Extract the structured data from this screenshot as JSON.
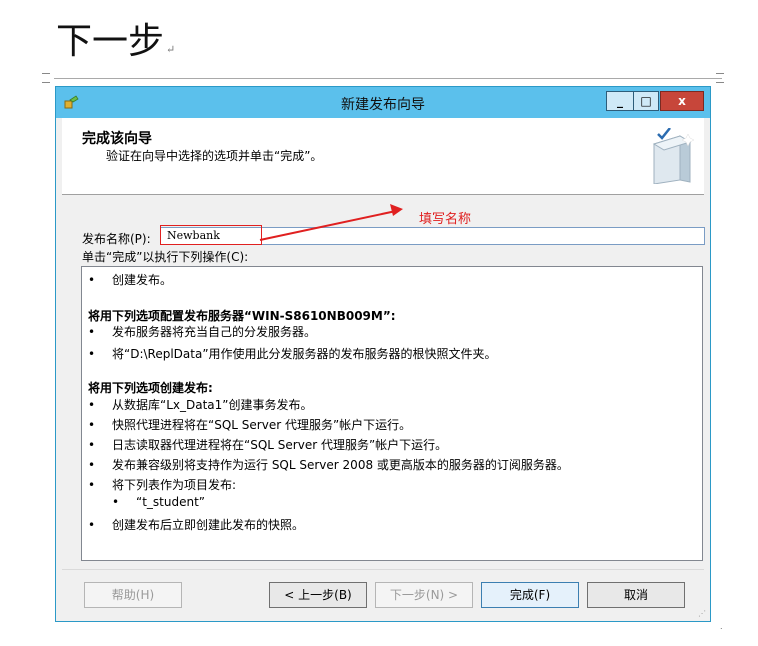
{
  "page": {
    "heading": "下一步",
    "heading_mark": "↵"
  },
  "window": {
    "title": "新建发布向导",
    "minimize_label": "_",
    "maximize_label": "□",
    "close_label": "x"
  },
  "header": {
    "title": "完成该向导",
    "subtitle": "验证在向导中选择的选项并单击“完成”。"
  },
  "form": {
    "name_label": "发布名称(P):",
    "name_value": "Newbank",
    "actions_label": "单击“完成”以执行下列操作(C):"
  },
  "annotation": {
    "text": "填写名称",
    "color": "#e02020"
  },
  "actions": [
    {
      "type": "bullet",
      "text": "创建发布。"
    },
    {
      "type": "heading",
      "text": "将用下列选项配置发布服务器“WIN-S8610NB009M”:"
    },
    {
      "type": "bullet",
      "text": "发布服务器将充当自己的分发服务器。"
    },
    {
      "type": "bullet",
      "text": "将“D:\\ReplData”用作使用此分发服务器的发布服务器的根快照文件夹。"
    },
    {
      "type": "heading",
      "text": "将用下列选项创建发布:"
    },
    {
      "type": "bullet",
      "text": "从数据库“Lx_Data1”创建事务发布。"
    },
    {
      "type": "bullet",
      "text": "快照代理进程将在“SQL Server 代理服务”帐户下运行。"
    },
    {
      "type": "bullet",
      "text": "日志读取器代理进程将在“SQL Server 代理服务”帐户下运行。"
    },
    {
      "type": "bullet",
      "text": "发布兼容级别将支持作为运行 SQL Server 2008 或更高版本的服务器的订阅服务器。"
    },
    {
      "type": "bullet",
      "text": "将下列表作为项目发布:"
    },
    {
      "type": "subbullet",
      "text": "“t_student”"
    },
    {
      "type": "bullet",
      "text": "创建发布后立即创建此发布的快照。"
    }
  ],
  "buttons": {
    "help": "帮助(H)",
    "back": "< 上一步(B)",
    "next": "下一步(N) >",
    "finish": "完成(F)",
    "cancel": "取消"
  },
  "colors": {
    "titlebar": "#5bc0ec",
    "close": "#c7463a"
  }
}
